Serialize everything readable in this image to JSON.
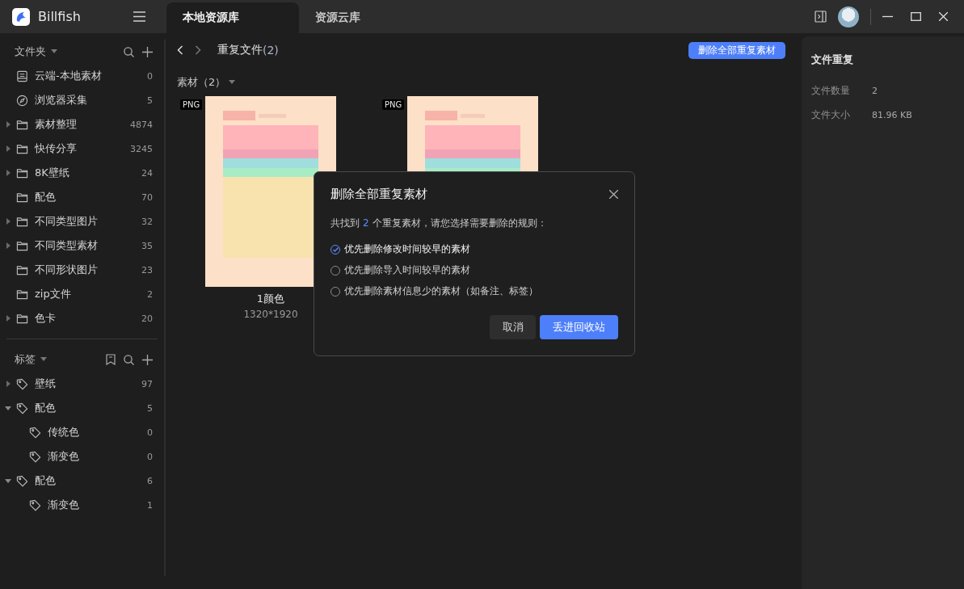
{
  "app": {
    "name": "Billfish"
  },
  "tabs": [
    {
      "label": "本地资源库",
      "selected": true
    },
    {
      "label": "资源云库",
      "selected": false
    }
  ],
  "sidebar": {
    "folders_header": "文件夹",
    "folders": [
      {
        "kind": "cloud",
        "label": "云端-本地素材",
        "count": "0",
        "expandable": false
      },
      {
        "kind": "browser",
        "label": "浏览器采集",
        "count": "5",
        "expandable": false
      },
      {
        "kind": "folder",
        "label": "素材整理",
        "count": "4874",
        "expandable": true
      },
      {
        "kind": "folder",
        "label": "快传分享",
        "count": "3245",
        "expandable": true
      },
      {
        "kind": "folder",
        "label": "8K壁纸",
        "count": "24",
        "expandable": true
      },
      {
        "kind": "folder",
        "label": "配色",
        "count": "70",
        "expandable": false
      },
      {
        "kind": "folder",
        "label": "不同类型图片",
        "count": "32",
        "expandable": true
      },
      {
        "kind": "folder",
        "label": "不同类型素材",
        "count": "35",
        "expandable": true
      },
      {
        "kind": "folder",
        "label": "不同形状图片",
        "count": "23",
        "expandable": false
      },
      {
        "kind": "folder",
        "label": "zip文件",
        "count": "2",
        "expandable": false
      },
      {
        "kind": "folder",
        "label": "色卡",
        "count": "20",
        "expandable": true
      }
    ],
    "tags_header": "标签",
    "tags": [
      {
        "label": "壁纸",
        "count": "97",
        "expanded": false
      },
      {
        "label": "配色",
        "count": "5",
        "expanded": true,
        "children": [
          {
            "label": "传统色",
            "count": "0"
          },
          {
            "label": "渐变色",
            "count": "0"
          }
        ]
      },
      {
        "label": "配色",
        "count": "6",
        "expanded": true,
        "children": [
          {
            "label": "渐变色",
            "count": "1"
          }
        ]
      }
    ]
  },
  "header": {
    "title": "重复文件",
    "count": "(2)",
    "action": "删除全部重复素材"
  },
  "group": {
    "label": "素材（2）"
  },
  "items": [
    {
      "format": "PNG",
      "kind": "picture",
      "name": "1颜色",
      "size": "1320*1920"
    },
    {
      "format": "PNG",
      "kind": "picture"
    }
  ],
  "info_panel": {
    "title": "文件重复",
    "rows": [
      {
        "label": "文件数量",
        "value": "2"
      },
      {
        "label": "文件大小",
        "value": "81.96 KB"
      }
    ]
  },
  "dialog": {
    "title": "删除全部重复素材",
    "message_before": "共找到",
    "message_count": "2",
    "message_after": "个重复素材，请您选择需要删除的规则：",
    "options": [
      {
        "label": "优先删除修改时间较早的素材",
        "selected": true
      },
      {
        "label": "优先删除导入时间较早的素材",
        "selected": false
      },
      {
        "label": "优先删除素材信息少的素材（如备注、标签）",
        "selected": false
      }
    ],
    "cancel": "取消",
    "confirm": "丢进回收站"
  }
}
